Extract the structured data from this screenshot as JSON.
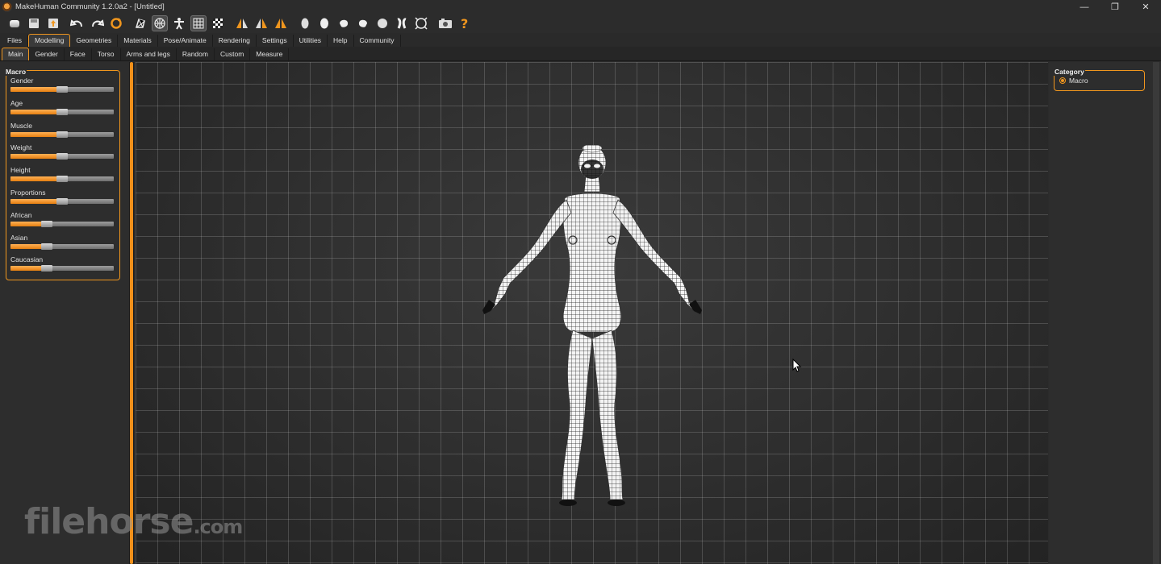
{
  "window": {
    "title": "MakeHuman Community 1.2.0a2 - [Untitled]",
    "controls": [
      "—",
      "❐",
      "✕"
    ]
  },
  "toolbar": {
    "icons": [
      "new-file-icon",
      "save-icon",
      "export-icon",
      "undo-icon",
      "redo-icon",
      "reset-icon",
      "smooth-icon",
      "wireframe-icon",
      "pose-icon",
      "grid-icon",
      "background-icon",
      "symmetry-right-icon",
      "symmetry-left-icon",
      "symmetry-icon",
      "front-view-icon",
      "back-view-icon",
      "left-view-icon",
      "right-view-icon",
      "top-view-icon",
      "bottom-view-icon",
      "reset-camera-icon",
      "screenshot-icon",
      "help-icon"
    ]
  },
  "menu_tabs": [
    {
      "label": "Files"
    },
    {
      "label": "Modelling"
    },
    {
      "label": "Geometries"
    },
    {
      "label": "Materials"
    },
    {
      "label": "Pose/Animate"
    },
    {
      "label": "Rendering"
    },
    {
      "label": "Settings"
    },
    {
      "label": "Utilities"
    },
    {
      "label": "Help"
    },
    {
      "label": "Community"
    }
  ],
  "active_menu_tab": "Modelling",
  "sub_tabs": [
    {
      "label": "Main"
    },
    {
      "label": "Gender"
    },
    {
      "label": "Face"
    },
    {
      "label": "Torso"
    },
    {
      "label": "Arms and legs"
    },
    {
      "label": "Random"
    },
    {
      "label": "Custom"
    },
    {
      "label": "Measure"
    }
  ],
  "active_sub_tab": "Main",
  "macro_panel": {
    "title": "Macro",
    "sliders": [
      {
        "label": "Gender",
        "value": 0.5
      },
      {
        "label": "Age",
        "value": 0.5
      },
      {
        "label": "Muscle",
        "value": 0.5
      },
      {
        "label": "Weight",
        "value": 0.5
      },
      {
        "label": "Height",
        "value": 0.5
      },
      {
        "label": "Proportions",
        "value": 0.5
      },
      {
        "label": "African",
        "value": 0.333
      },
      {
        "label": "Asian",
        "value": 0.333
      },
      {
        "label": "Caucasian",
        "value": 0.333
      }
    ]
  },
  "category_panel": {
    "title": "Category",
    "option": "Macro"
  },
  "watermark": {
    "text": "filehorse",
    "suffix": ".com"
  },
  "colors": {
    "accent": "#f0961e",
    "background": "#2b2b2b",
    "mesh": "#ffffff"
  }
}
